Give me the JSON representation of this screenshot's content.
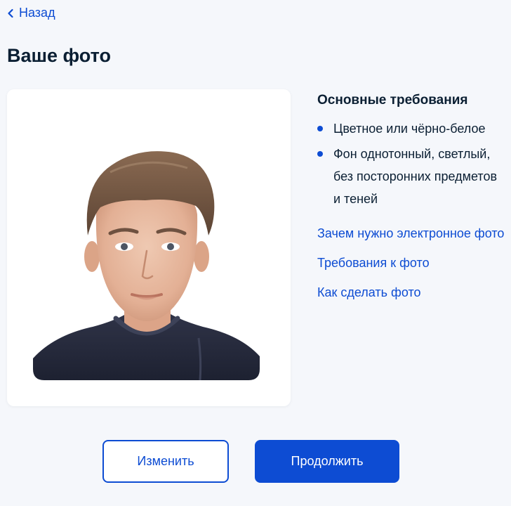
{
  "header": {
    "back_label": "Назад",
    "title": "Ваше фото"
  },
  "requirements": {
    "title": "Основные требования",
    "items": [
      "Цветное или чёрно-белое",
      "Фон однотонный, светлый, без посторонних предметов и теней"
    ]
  },
  "links": [
    "Зачем нужно электронное фото",
    "Требования к фото",
    "Как сделать фото"
  ],
  "actions": {
    "change_label": "Изменить",
    "continue_label": "Продолжить"
  },
  "colors": {
    "accent": "#0d4cd3",
    "background": "#f5f7fb",
    "text": "#0b1f33"
  }
}
